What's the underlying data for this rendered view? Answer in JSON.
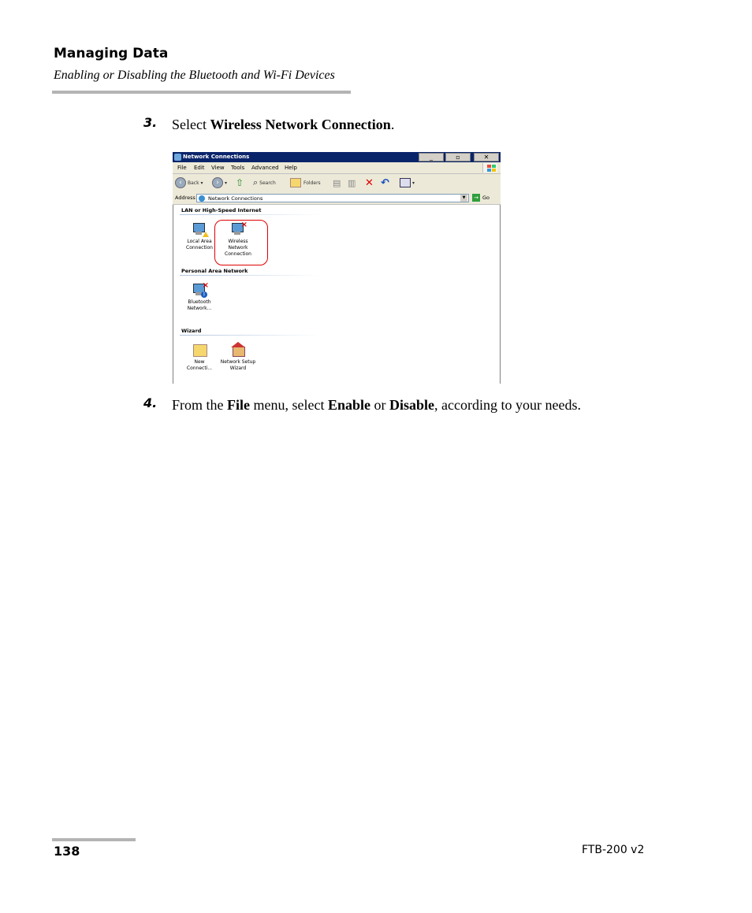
{
  "header": {
    "title": "Managing Data",
    "subtitle": "Enabling or Disabling the Bluetooth and Wi-Fi Devices"
  },
  "steps": [
    {
      "number": "3.",
      "parts": [
        "Select ",
        "Wireless Network Connection",
        "."
      ]
    },
    {
      "number": "4.",
      "parts": [
        "From the ",
        "File",
        " menu, select ",
        "Enable",
        " or ",
        "Disable",
        ", according to your needs."
      ]
    }
  ],
  "window": {
    "title": "Network Connections",
    "menu": [
      "File",
      "Edit",
      "View",
      "Tools",
      "Advanced",
      "Help"
    ],
    "toolbar": {
      "back": "Back",
      "search": "Search",
      "folders": "Folders"
    },
    "address_label": "Address",
    "address_value": "Network Connections",
    "go_label": "Go",
    "groups": [
      {
        "title": "LAN or High-Speed Internet",
        "items": [
          {
            "label_lines": [
              "Local Area",
              "Connection"
            ],
            "icon": "network-warning-icon"
          },
          {
            "label_lines": [
              "Wireless",
              "Network",
              "Connection"
            ],
            "icon": "wireless-disabled-icon"
          }
        ]
      },
      {
        "title": "Personal Area Network",
        "items": [
          {
            "label_lines": [
              "Bluetooth",
              "Network..."
            ],
            "icon": "bluetooth-network-icon"
          }
        ]
      },
      {
        "title": "Wizard",
        "items": [
          {
            "label_lines": [
              "New",
              "Connecti..."
            ],
            "icon": "new-connection-icon"
          },
          {
            "label_lines": [
              "Network Setup",
              "Wizard"
            ],
            "icon": "network-setup-wizard-icon"
          }
        ]
      }
    ]
  },
  "footer": {
    "page_number": "138",
    "product": "FTB-200 v2"
  },
  "colors": {
    "titlebar": "#0a246a",
    "highlight": "#e00000",
    "rule": "#b4b4b4"
  }
}
